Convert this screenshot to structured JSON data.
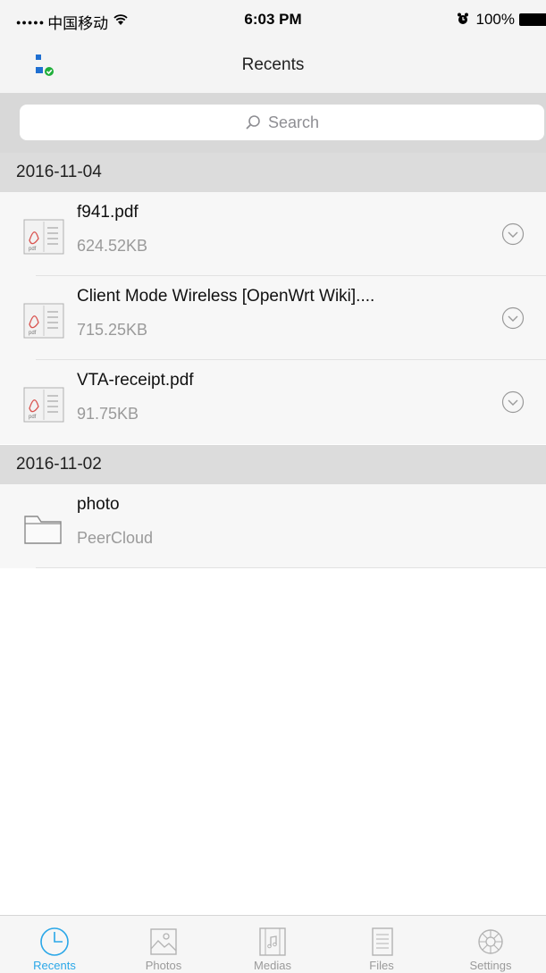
{
  "status_bar": {
    "signal_dots": "●●●●●",
    "carrier": "中国移动",
    "time": "6:03 PM",
    "battery": "100%"
  },
  "nav": {
    "title": "Recents"
  },
  "search": {
    "placeholder": "Search"
  },
  "sections": [
    {
      "date": "2016-11-04",
      "items": [
        {
          "name": "f941.pdf",
          "size": "624.52KB",
          "icon": "pdf-file-icon"
        },
        {
          "name": "Client Mode Wireless [OpenWrt Wiki]....",
          "size": "715.25KB",
          "icon": "pdf-file-icon"
        },
        {
          "name": "VTA-receipt.pdf",
          "size": "91.75KB",
          "icon": "pdf-file-icon"
        }
      ]
    },
    {
      "date": "2016-11-02",
      "items": [
        {
          "name": "photo",
          "size": "PeerCloud",
          "icon": "folder-icon"
        }
      ]
    }
  ],
  "tabs": [
    {
      "label": "Recents",
      "active": true
    },
    {
      "label": "Photos"
    },
    {
      "label": "Medias"
    },
    {
      "label": "Files"
    },
    {
      "label": "Settings"
    }
  ],
  "colors": {
    "accent": "#2aa7e8",
    "status_green": "#1fae3a",
    "device_blue": "#1f6fd1"
  }
}
